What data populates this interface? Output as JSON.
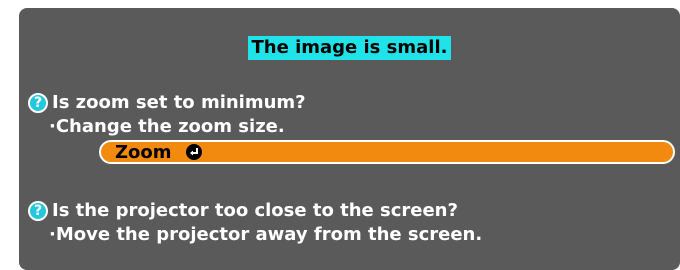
{
  "title": "The image is small.",
  "question1": {
    "icon": "help-icon",
    "text": "Is zoom set to minimum?",
    "action": "·Change the zoom size."
  },
  "zoom_button": {
    "label": "Zoom",
    "icon": "enter-icon"
  },
  "question2": {
    "icon": "help-icon",
    "text": "Is the projector too close to the screen?",
    "action": "·Move the projector away from the screen."
  },
  "colors": {
    "panel": "#5a5a5a",
    "title_bg": "#1fe3e8",
    "help_icon": "#23c8dc",
    "button": "#f18a0f"
  }
}
